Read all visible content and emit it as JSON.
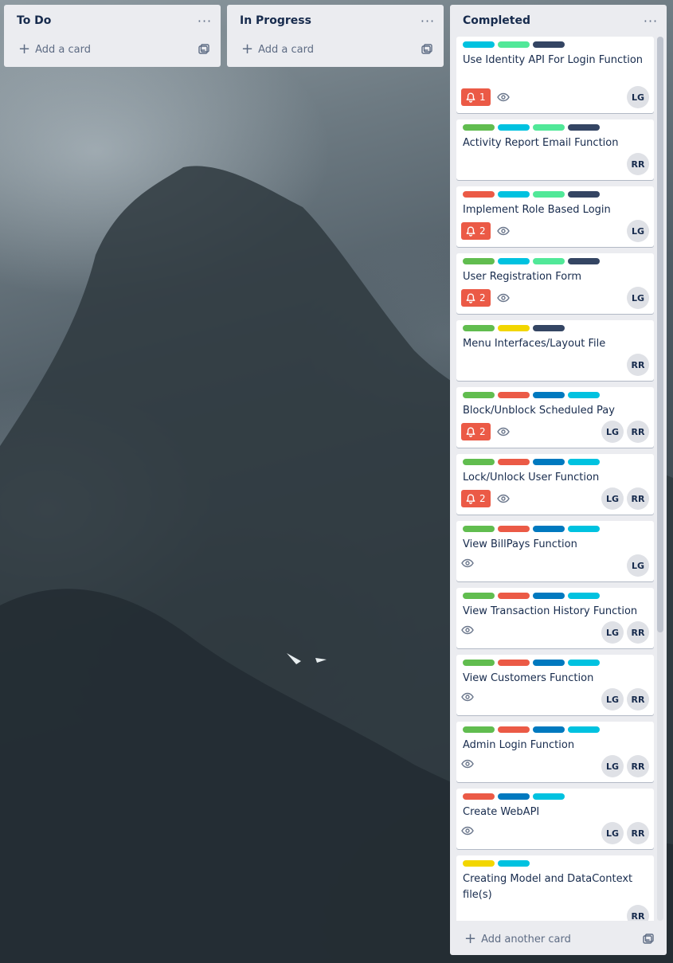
{
  "board": {
    "lists": [
      {
        "title": "To Do",
        "add_label": "Add a card"
      },
      {
        "title": "In Progress",
        "add_label": "Add a card"
      },
      {
        "title": "Completed",
        "add_label": "Add another card"
      }
    ],
    "menu_glyph": "···"
  },
  "colors": {
    "green": "#61bd4f",
    "red": "#eb5a46",
    "sky": "#00c2e0",
    "lime": "#51e898",
    "navy": "#344563",
    "blue": "#0079bf",
    "yellow": "#f2d600",
    "list_bg": "#ebecf0",
    "card_bg": "#ffffff"
  },
  "cards": [
    {
      "labels": [
        "sky",
        "lime",
        "navy"
      ],
      "title": "Use Identity API For Login Function",
      "notifications": "1",
      "watch": true,
      "members": [
        "LG"
      ]
    },
    {
      "labels": [
        "green",
        "sky",
        "lime",
        "navy"
      ],
      "title": "Activity Report Email Function",
      "notifications": null,
      "watch": false,
      "members": [
        "RR"
      ]
    },
    {
      "labels": [
        "red",
        "sky",
        "lime",
        "navy"
      ],
      "title": "Implement Role Based Login",
      "notifications": "2",
      "watch": true,
      "members": [
        "LG"
      ]
    },
    {
      "labels": [
        "green",
        "sky",
        "lime",
        "navy"
      ],
      "title": "User Registration Form",
      "notifications": "2",
      "watch": true,
      "members": [
        "LG"
      ]
    },
    {
      "labels": [
        "green",
        "yellow",
        "navy"
      ],
      "title": "Menu Interfaces/Layout File",
      "notifications": null,
      "watch": false,
      "members": [
        "RR"
      ]
    },
    {
      "labels": [
        "green",
        "red",
        "blue",
        "sky"
      ],
      "title": "Block/Unblock Scheduled Pay",
      "notifications": "2",
      "watch": true,
      "members": [
        "LG",
        "RR"
      ]
    },
    {
      "labels": [
        "green",
        "red",
        "blue",
        "sky"
      ],
      "title": "Lock/Unlock User Function",
      "notifications": "2",
      "watch": true,
      "members": [
        "LG",
        "RR"
      ]
    },
    {
      "labels": [
        "green",
        "red",
        "blue",
        "sky"
      ],
      "title": "View BillPays Function",
      "notifications": null,
      "watch": true,
      "members": [
        "LG"
      ]
    },
    {
      "labels": [
        "green",
        "red",
        "blue",
        "sky"
      ],
      "title": "View Transaction History Function",
      "notifications": null,
      "watch": true,
      "members": [
        "LG",
        "RR"
      ]
    },
    {
      "labels": [
        "green",
        "red",
        "blue",
        "sky"
      ],
      "title": "View Customers Function",
      "notifications": null,
      "watch": true,
      "members": [
        "LG",
        "RR"
      ]
    },
    {
      "labels": [
        "green",
        "red",
        "blue",
        "sky"
      ],
      "title": "Admin Login Function",
      "notifications": null,
      "watch": true,
      "members": [
        "LG",
        "RR"
      ]
    },
    {
      "labels": [
        "red",
        "blue",
        "sky"
      ],
      "title": "Create WebAPI",
      "notifications": null,
      "watch": true,
      "members": [
        "LG",
        "RR"
      ]
    },
    {
      "labels": [
        "yellow",
        "sky"
      ],
      "title": "Creating Model and DataContext file(s)",
      "notifications": null,
      "watch": false,
      "members": [
        "RR"
      ]
    }
  ]
}
